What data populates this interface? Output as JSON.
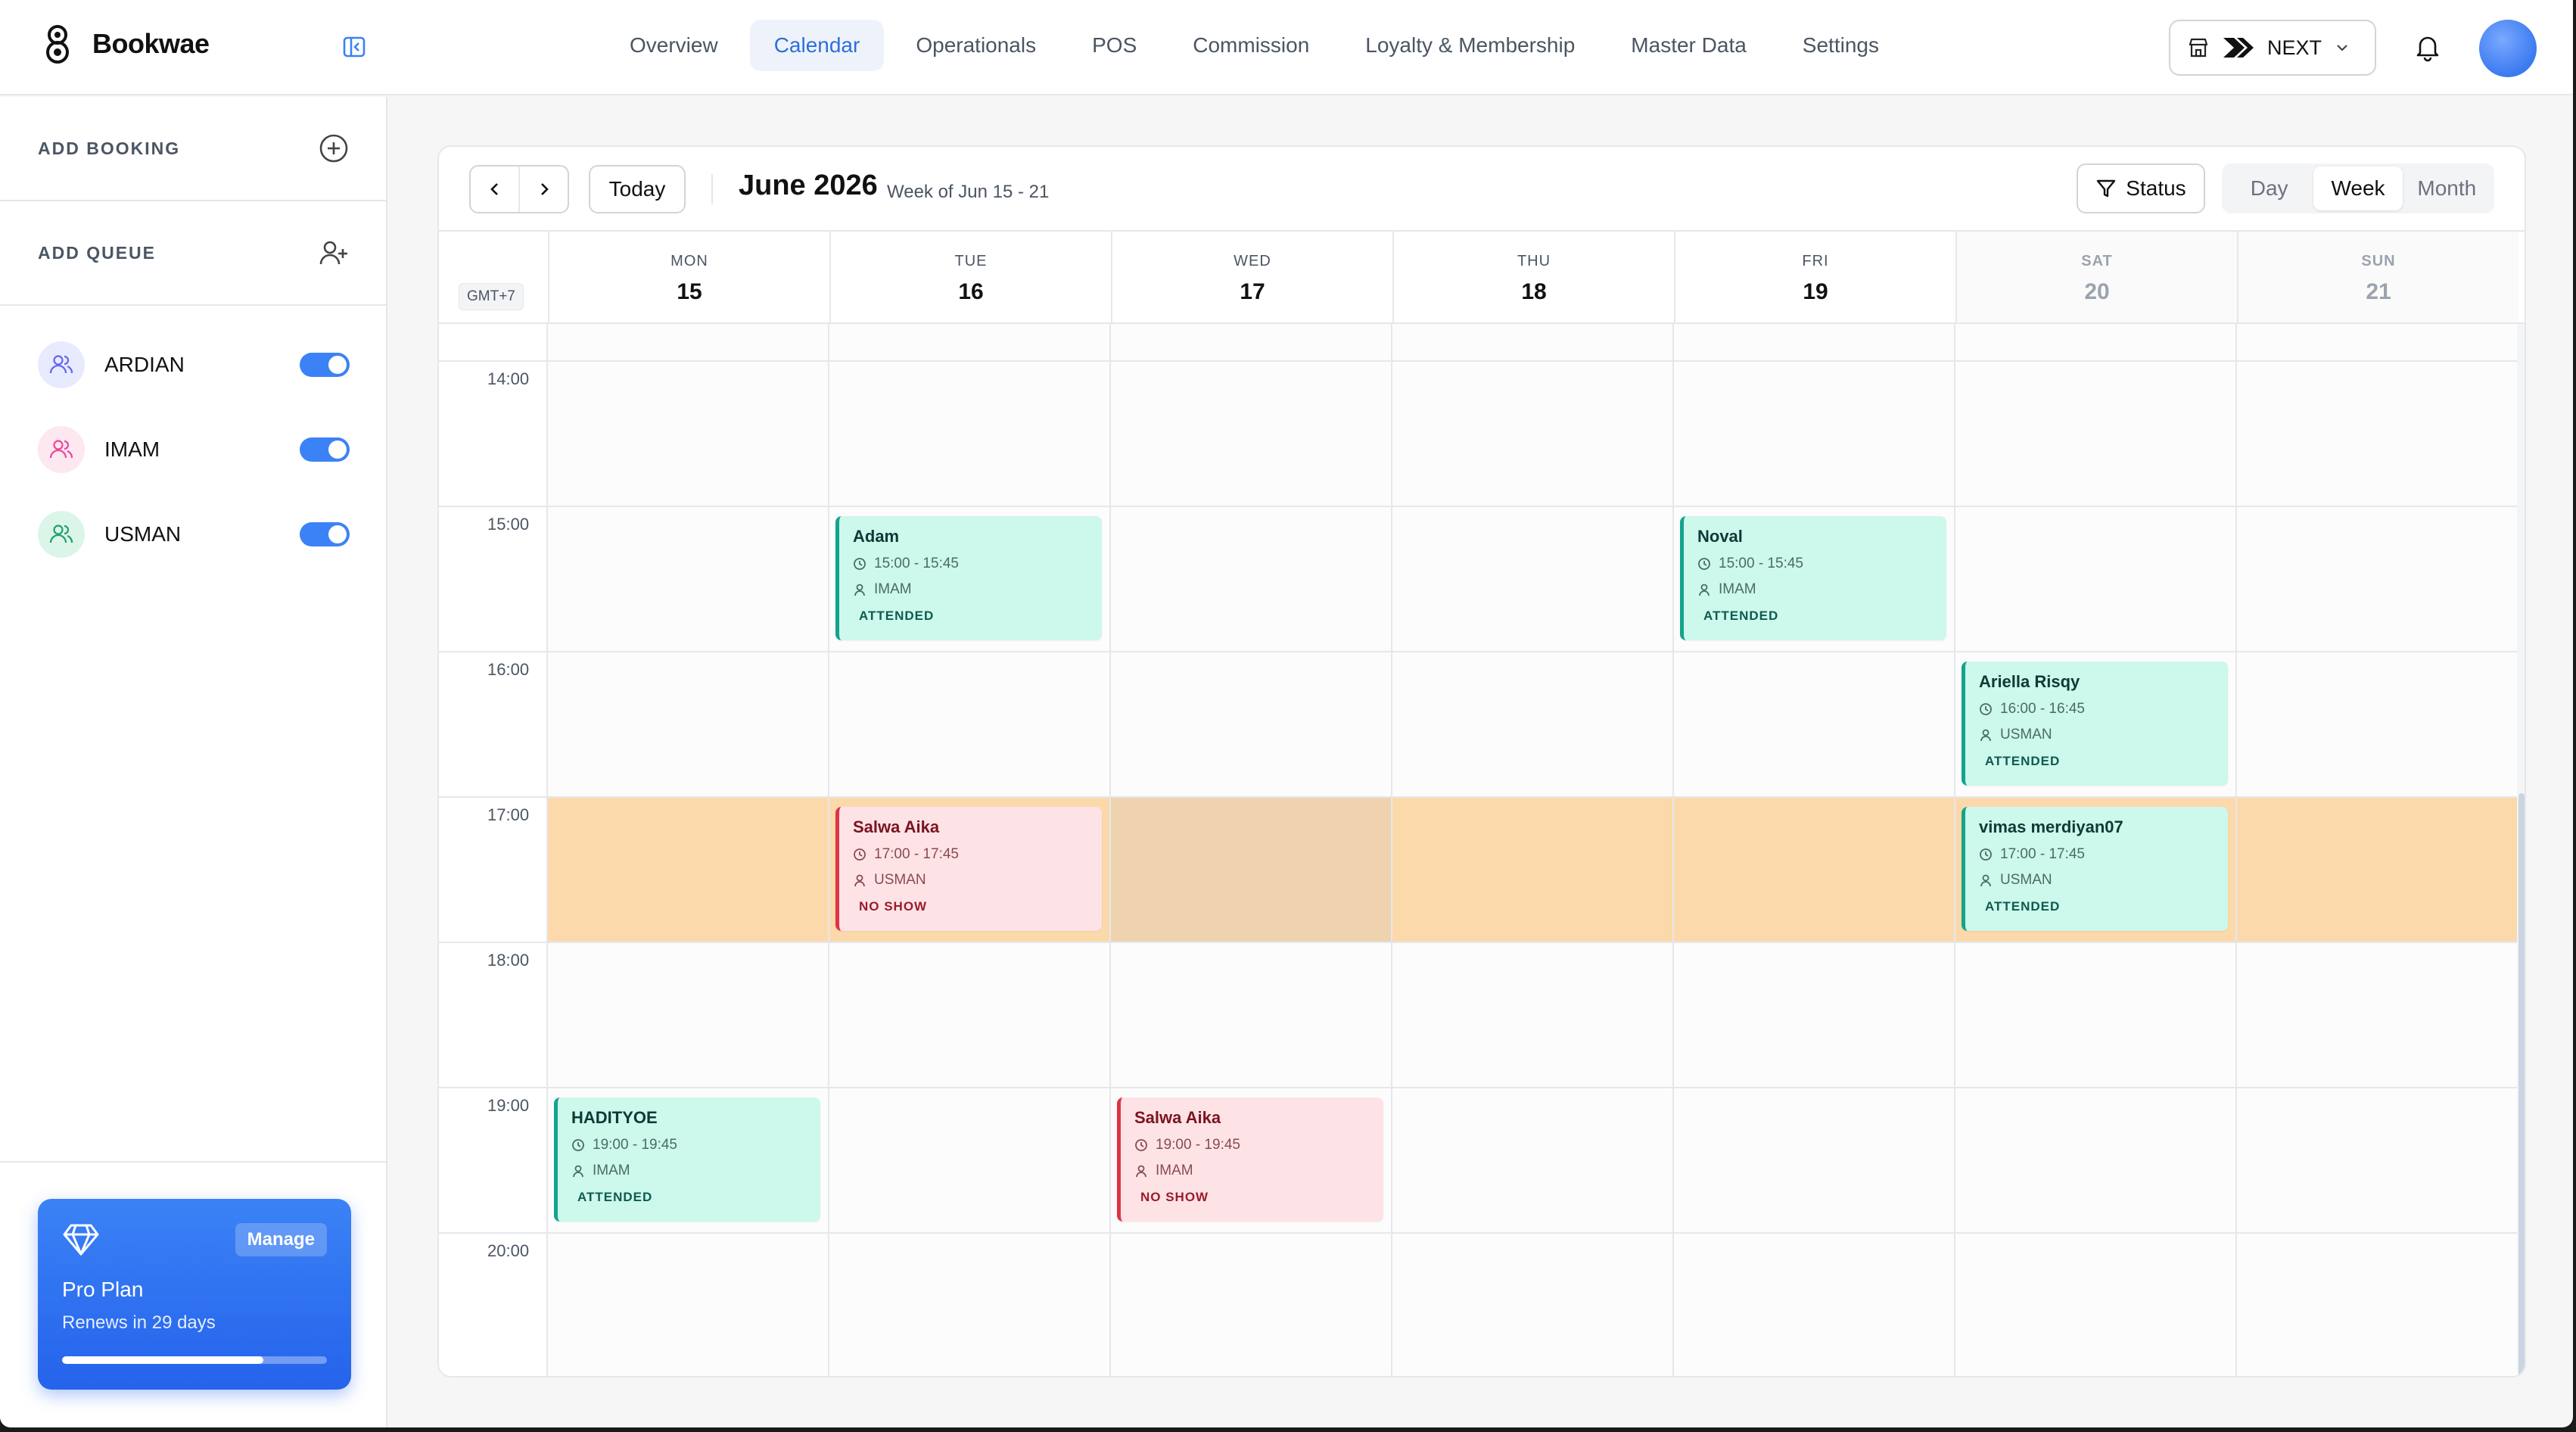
{
  "app": {
    "name": "Bookwae"
  },
  "nav": {
    "items": [
      {
        "label": "Overview",
        "active": false
      },
      {
        "label": "Calendar",
        "active": true
      },
      {
        "label": "Operationals",
        "active": false
      },
      {
        "label": "POS",
        "active": false
      },
      {
        "label": "Commission",
        "active": false
      },
      {
        "label": "Loyalty & Membership",
        "active": false
      },
      {
        "label": "Master Data",
        "active": false
      },
      {
        "label": "Settings",
        "active": false
      }
    ],
    "workspace_label": "NEXT"
  },
  "sidebar": {
    "add_booking": "ADD BOOKING",
    "add_queue": "ADD QUEUE",
    "staff": [
      {
        "name": "ARDIAN",
        "enabled": true,
        "color": "#6366f1",
        "bg": "#e8eafd"
      },
      {
        "name": "IMAM",
        "enabled": true,
        "color": "#ec4899",
        "bg": "#fde7f1"
      },
      {
        "name": "USMAN",
        "enabled": true,
        "color": "#22a06b",
        "bg": "#dcf5e9"
      }
    ],
    "plan": {
      "title": "Pro Plan",
      "subtitle": "Renews in 29 days",
      "manage_label": "Manage",
      "progress": 0.76
    }
  },
  "calendar": {
    "month_title": "June 2026",
    "week_label": "Week of Jun 15 - 21",
    "today_label": "Today",
    "status_label": "Status",
    "views": [
      {
        "label": "Day",
        "active": false
      },
      {
        "label": "Week",
        "active": true
      },
      {
        "label": "Month",
        "active": false
      }
    ],
    "timezone": "GMT+7",
    "days": [
      {
        "name": "MON",
        "num": "15",
        "weekend": false
      },
      {
        "name": "TUE",
        "num": "16",
        "weekend": false
      },
      {
        "name": "WED",
        "num": "17",
        "weekend": false
      },
      {
        "name": "THU",
        "num": "18",
        "weekend": false
      },
      {
        "name": "FRI",
        "num": "19",
        "weekend": false
      },
      {
        "name": "SAT",
        "num": "20",
        "weekend": true
      },
      {
        "name": "SUN",
        "num": "21",
        "weekend": true
      }
    ],
    "hours": [
      "14:00",
      "15:00",
      "16:00",
      "17:00",
      "18:00",
      "19:00",
      "20:00"
    ],
    "current_hour": "17:00",
    "highlight_day": "WED",
    "events": [
      {
        "day": "TUE",
        "start": "15:00",
        "name": "Adam",
        "time": "15:00 - 15:45",
        "staff": "IMAM",
        "status": "ATTENDED"
      },
      {
        "day": "FRI",
        "start": "15:00",
        "name": "Noval",
        "time": "15:00 - 15:45",
        "staff": "IMAM",
        "status": "ATTENDED"
      },
      {
        "day": "SAT",
        "start": "16:00",
        "name": "Ariella Risqy",
        "time": "16:00 - 16:45",
        "staff": "USMAN",
        "status": "ATTENDED"
      },
      {
        "day": "TUE",
        "start": "17:00",
        "name": "Salwa Aika",
        "time": "17:00 - 17:45",
        "staff": "USMAN",
        "status": "NO SHOW"
      },
      {
        "day": "SAT",
        "start": "17:00",
        "name": "vimas merdiyan07",
        "time": "17:00 - 17:45",
        "staff": "USMAN",
        "status": "ATTENDED"
      },
      {
        "day": "MON",
        "start": "19:00",
        "name": "HADITYOE",
        "time": "19:00 - 19:45",
        "staff": "IMAM",
        "status": "ATTENDED"
      },
      {
        "day": "WED",
        "start": "19:00",
        "name": "Salwa Aika",
        "time": "19:00 - 19:45",
        "staff": "IMAM",
        "status": "NO SHOW"
      }
    ]
  },
  "colors": {
    "accent": "#3b82f6",
    "attended_bg": "#cdf8ec",
    "attended_border": "#14a38b",
    "noshow_bg": "#fde3e6",
    "noshow_border": "#dc3545",
    "current_hour_row": "#fcd9ab"
  }
}
